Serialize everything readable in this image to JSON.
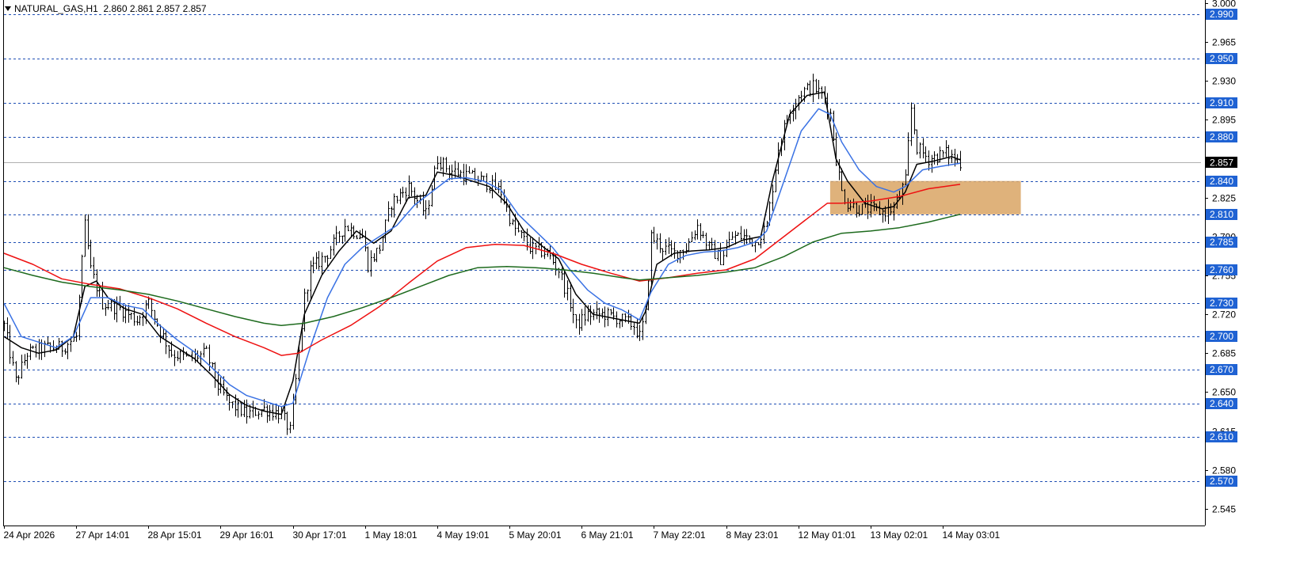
{
  "header": {
    "symbol": "NATURAL_GAS,H1",
    "ohlc": "2.860 2.861 2.857 2.857"
  },
  "current_price": "2.857",
  "colors": {
    "background": "#ffffff",
    "candle": "#000000",
    "hline": "#1f4fb4",
    "label_bg": "#1f62d3",
    "current_label_bg": "#000000",
    "ma_fast": "#000000",
    "ma_blue": "#3a72e4",
    "ma_red": "#ee1111",
    "ma_green": "#1d6a1d",
    "zone": "#d9a464"
  },
  "chart_data": {
    "type": "line",
    "y_axis": {
      "range": [
        2.53,
        3.0
      ],
      "tick_labels": [
        "3.000",
        "2.965",
        "2.930",
        "2.895",
        "2.825",
        "2.790",
        "2.755",
        "2.720",
        "2.685",
        "2.650",
        "2.615",
        "2.580",
        "2.545"
      ],
      "tick_values": [
        3.0,
        2.965,
        2.93,
        2.895,
        2.825,
        2.79,
        2.755,
        2.72,
        2.685,
        2.65,
        2.615,
        2.58,
        2.545
      ]
    },
    "x_axis": {
      "tick_labels": [
        "24 Apr 2026",
        "27 Apr 14:01",
        "28 Apr 15:01",
        "29 Apr 16:01",
        "30 Apr 17:01",
        "1 May 18:01",
        "4 May 19:01",
        "5 May 20:01",
        "6 May 21:01",
        "7 May 22:01",
        "8 May 23:01",
        "12 May 01:01",
        "13 May 02:01",
        "14 May 03:01"
      ],
      "tick_index": [
        0,
        25,
        50,
        75,
        100,
        125,
        150,
        175,
        200,
        225,
        250,
        275,
        300,
        325
      ],
      "total_bars": 332
    },
    "horizontal_levels": [
      {
        "value": 2.99,
        "label": "2.990"
      },
      {
        "value": 2.95,
        "label": "2.950"
      },
      {
        "value": 2.91,
        "label": "2.910"
      },
      {
        "value": 2.88,
        "label": "2.880"
      },
      {
        "value": 2.84,
        "label": "2.840"
      },
      {
        "value": 2.81,
        "label": "2.810"
      },
      {
        "value": 2.785,
        "label": "2.785"
      },
      {
        "value": 2.76,
        "label": "2.760"
      },
      {
        "value": 2.73,
        "label": "2.730"
      },
      {
        "value": 2.7,
        "label": "2.700"
      },
      {
        "value": 2.67,
        "label": "2.670"
      },
      {
        "value": 2.64,
        "label": "2.640"
      },
      {
        "value": 2.61,
        "label": "2.610"
      },
      {
        "value": 2.57,
        "label": "2.570"
      }
    ],
    "current_price_value": 2.857,
    "zone": {
      "x_from_bar": 286,
      "x_to_bar": 352,
      "price_low": 2.81,
      "price_high": 2.84
    },
    "price_anchors": [
      [
        0,
        2.71
      ],
      [
        4,
        2.66
      ],
      [
        8,
        2.685
      ],
      [
        14,
        2.69
      ],
      [
        20,
        2.69
      ],
      [
        25,
        2.7
      ],
      [
        28,
        2.8
      ],
      [
        30,
        2.76
      ],
      [
        34,
        2.73
      ],
      [
        40,
        2.725
      ],
      [
        46,
        2.715
      ],
      [
        50,
        2.73
      ],
      [
        54,
        2.705
      ],
      [
        58,
        2.685
      ],
      [
        64,
        2.68
      ],
      [
        70,
        2.685
      ],
      [
        74,
        2.655
      ],
      [
        78,
        2.64
      ],
      [
        84,
        2.63
      ],
      [
        90,
        2.635
      ],
      [
        96,
        2.63
      ],
      [
        99,
        2.615
      ],
      [
        101,
        2.66
      ],
      [
        104,
        2.735
      ],
      [
        106,
        2.76
      ],
      [
        112,
        2.775
      ],
      [
        118,
        2.8
      ],
      [
        124,
        2.79
      ],
      [
        126,
        2.765
      ],
      [
        130,
        2.78
      ],
      [
        134,
        2.82
      ],
      [
        140,
        2.835
      ],
      [
        146,
        2.81
      ],
      [
        150,
        2.86
      ],
      [
        154,
        2.85
      ],
      [
        160,
        2.845
      ],
      [
        166,
        2.84
      ],
      [
        172,
        2.83
      ],
      [
        176,
        2.8
      ],
      [
        182,
        2.78
      ],
      [
        188,
        2.775
      ],
      [
        192,
        2.76
      ],
      [
        196,
        2.73
      ],
      [
        198,
        2.71
      ],
      [
        202,
        2.72
      ],
      [
        208,
        2.72
      ],
      [
        214,
        2.715
      ],
      [
        218,
        2.71
      ],
      [
        220,
        2.7
      ],
      [
        222,
        2.72
      ],
      [
        224,
        2.79
      ],
      [
        228,
        2.78
      ],
      [
        232,
        2.775
      ],
      [
        236,
        2.78
      ],
      [
        240,
        2.8
      ],
      [
        244,
        2.78
      ],
      [
        248,
        2.77
      ],
      [
        252,
        2.79
      ],
      [
        256,
        2.79
      ],
      [
        260,
        2.785
      ],
      [
        264,
        2.8
      ],
      [
        268,
        2.87
      ],
      [
        272,
        2.905
      ],
      [
        276,
        2.92
      ],
      [
        280,
        2.925
      ],
      [
        284,
        2.915
      ],
      [
        286,
        2.9
      ],
      [
        288,
        2.86
      ],
      [
        290,
        2.83
      ],
      [
        292,
        2.82
      ],
      [
        296,
        2.815
      ],
      [
        300,
        2.815
      ],
      [
        304,
        2.812
      ],
      [
        308,
        2.815
      ],
      [
        312,
        2.84
      ],
      [
        314,
        2.905
      ],
      [
        316,
        2.87
      ],
      [
        320,
        2.86
      ],
      [
        326,
        2.865
      ],
      [
        331,
        2.857
      ]
    ],
    "series": [
      {
        "name": "",
        "color": "#000000",
        "points": [
          [
            0,
            2.7
          ],
          [
            6,
            2.69
          ],
          [
            12,
            2.685
          ],
          [
            18,
            2.688
          ],
          [
            24,
            2.7
          ],
          [
            28,
            2.745
          ],
          [
            32,
            2.75
          ],
          [
            36,
            2.735
          ],
          [
            42,
            2.725
          ],
          [
            48,
            2.72
          ],
          [
            54,
            2.7
          ],
          [
            60,
            2.69
          ],
          [
            66,
            2.68
          ],
          [
            72,
            2.665
          ],
          [
            78,
            2.648
          ],
          [
            84,
            2.638
          ],
          [
            90,
            2.633
          ],
          [
            96,
            2.63
          ],
          [
            100,
            2.66
          ],
          [
            104,
            2.72
          ],
          [
            110,
            2.755
          ],
          [
            116,
            2.777
          ],
          [
            122,
            2.795
          ],
          [
            128,
            2.784
          ],
          [
            134,
            2.795
          ],
          [
            140,
            2.825
          ],
          [
            146,
            2.827
          ],
          [
            150,
            2.848
          ],
          [
            156,
            2.845
          ],
          [
            162,
            2.84
          ],
          [
            168,
            2.835
          ],
          [
            174,
            2.82
          ],
          [
            180,
            2.795
          ],
          [
            186,
            2.782
          ],
          [
            192,
            2.77
          ],
          [
            198,
            2.738
          ],
          [
            204,
            2.72
          ],
          [
            210,
            2.717
          ],
          [
            216,
            2.714
          ],
          [
            220,
            2.712
          ],
          [
            222,
            2.722
          ],
          [
            226,
            2.765
          ],
          [
            232,
            2.775
          ],
          [
            238,
            2.777
          ],
          [
            244,
            2.778
          ],
          [
            250,
            2.78
          ],
          [
            256,
            2.787
          ],
          [
            262,
            2.79
          ],
          [
            266,
            2.84
          ],
          [
            272,
            2.9
          ],
          [
            278,
            2.917
          ],
          [
            284,
            2.92
          ],
          [
            288,
            2.86
          ],
          [
            292,
            2.84
          ],
          [
            298,
            2.82
          ],
          [
            304,
            2.815
          ],
          [
            308,
            2.817
          ],
          [
            312,
            2.83
          ],
          [
            316,
            2.855
          ],
          [
            322,
            2.858
          ],
          [
            328,
            2.862
          ],
          [
            331,
            2.859
          ]
        ]
      },
      {
        "name": "",
        "color": "#3a72e4",
        "points": [
          [
            0,
            2.73
          ],
          [
            6,
            2.7
          ],
          [
            12,
            2.695
          ],
          [
            18,
            2.69
          ],
          [
            24,
            2.7
          ],
          [
            30,
            2.735
          ],
          [
            36,
            2.735
          ],
          [
            42,
            2.728
          ],
          [
            48,
            2.725
          ],
          [
            54,
            2.71
          ],
          [
            60,
            2.697
          ],
          [
            66,
            2.686
          ],
          [
            72,
            2.672
          ],
          [
            78,
            2.657
          ],
          [
            84,
            2.647
          ],
          [
            90,
            2.642
          ],
          [
            96,
            2.637
          ],
          [
            100,
            2.64
          ],
          [
            106,
            2.69
          ],
          [
            112,
            2.735
          ],
          [
            118,
            2.765
          ],
          [
            124,
            2.78
          ],
          [
            130,
            2.79
          ],
          [
            136,
            2.8
          ],
          [
            142,
            2.818
          ],
          [
            148,
            2.83
          ],
          [
            154,
            2.842
          ],
          [
            160,
            2.843
          ],
          [
            166,
            2.84
          ],
          [
            172,
            2.832
          ],
          [
            178,
            2.81
          ],
          [
            184,
            2.795
          ],
          [
            190,
            2.78
          ],
          [
            196,
            2.76
          ],
          [
            202,
            2.742
          ],
          [
            208,
            2.73
          ],
          [
            214,
            2.724
          ],
          [
            220,
            2.715
          ],
          [
            224,
            2.74
          ],
          [
            230,
            2.765
          ],
          [
            236,
            2.773
          ],
          [
            242,
            2.776
          ],
          [
            248,
            2.777
          ],
          [
            254,
            2.78
          ],
          [
            260,
            2.785
          ],
          [
            264,
            2.795
          ],
          [
            270,
            2.84
          ],
          [
            276,
            2.885
          ],
          [
            282,
            2.905
          ],
          [
            286,
            2.9
          ],
          [
            290,
            2.875
          ],
          [
            296,
            2.85
          ],
          [
            302,
            2.835
          ],
          [
            308,
            2.83
          ],
          [
            312,
            2.835
          ],
          [
            318,
            2.85
          ],
          [
            324,
            2.853
          ],
          [
            331,
            2.856
          ]
        ]
      },
      {
        "name": "",
        "color": "#ee1111",
        "points": [
          [
            0,
            2.775
          ],
          [
            10,
            2.765
          ],
          [
            20,
            2.752
          ],
          [
            30,
            2.747
          ],
          [
            40,
            2.743
          ],
          [
            50,
            2.735
          ],
          [
            60,
            2.725
          ],
          [
            70,
            2.712
          ],
          [
            80,
            2.7
          ],
          [
            90,
            2.69
          ],
          [
            96,
            2.683
          ],
          [
            102,
            2.685
          ],
          [
            110,
            2.697
          ],
          [
            120,
            2.71
          ],
          [
            130,
            2.727
          ],
          [
            140,
            2.748
          ],
          [
            150,
            2.768
          ],
          [
            160,
            2.78
          ],
          [
            170,
            2.783
          ],
          [
            180,
            2.782
          ],
          [
            190,
            2.775
          ],
          [
            200,
            2.765
          ],
          [
            210,
            2.757
          ],
          [
            220,
            2.75
          ],
          [
            230,
            2.753
          ],
          [
            240,
            2.757
          ],
          [
            250,
            2.76
          ],
          [
            260,
            2.77
          ],
          [
            270,
            2.79
          ],
          [
            280,
            2.81
          ],
          [
            285,
            2.82
          ],
          [
            290,
            2.82
          ],
          [
            300,
            2.822
          ],
          [
            310,
            2.826
          ],
          [
            320,
            2.833
          ],
          [
            331,
            2.837
          ]
        ]
      },
      {
        "name": "",
        "color": "#1d6a1d",
        "points": [
          [
            0,
            2.762
          ],
          [
            10,
            2.755
          ],
          [
            20,
            2.749
          ],
          [
            30,
            2.745
          ],
          [
            40,
            2.742
          ],
          [
            50,
            2.738
          ],
          [
            60,
            2.732
          ],
          [
            70,
            2.725
          ],
          [
            80,
            2.718
          ],
          [
            90,
            2.712
          ],
          [
            96,
            2.71
          ],
          [
            104,
            2.712
          ],
          [
            114,
            2.718
          ],
          [
            124,
            2.726
          ],
          [
            134,
            2.735
          ],
          [
            144,
            2.745
          ],
          [
            154,
            2.755
          ],
          [
            164,
            2.762
          ],
          [
            174,
            2.763
          ],
          [
            184,
            2.762
          ],
          [
            194,
            2.76
          ],
          [
            204,
            2.757
          ],
          [
            214,
            2.753
          ],
          [
            220,
            2.751
          ],
          [
            230,
            2.753
          ],
          [
            240,
            2.755
          ],
          [
            250,
            2.758
          ],
          [
            260,
            2.762
          ],
          [
            270,
            2.772
          ],
          [
            280,
            2.785
          ],
          [
            290,
            2.793
          ],
          [
            300,
            2.795
          ],
          [
            310,
            2.798
          ],
          [
            320,
            2.803
          ],
          [
            331,
            2.81
          ]
        ]
      }
    ]
  }
}
